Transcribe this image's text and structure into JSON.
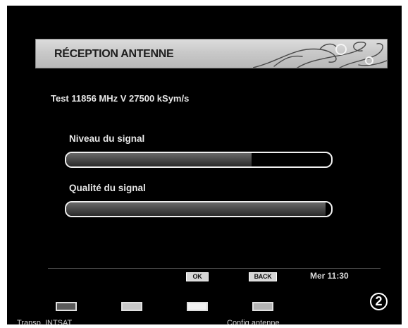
{
  "header": {
    "title": "RÉCEPTION ANTENNE"
  },
  "test_line": "Test 11856 MHz V 27500 kSym/s",
  "meters": [
    {
      "label": "Niveau du signal",
      "level_percent": 70
    },
    {
      "label": "Qualité du signal",
      "level_percent": 98
    }
  ],
  "keys": {
    "ok_label": "OK",
    "back_label": "BACK"
  },
  "clock": "Mer 11:30",
  "color_keys": [
    {
      "color": "#5a5a5a",
      "label": "Transp. INTSAT"
    },
    {
      "color": "#c8c8c8",
      "label": ""
    },
    {
      "color": "#f2f2f2",
      "label": ""
    },
    {
      "color": "#b4b4b4",
      "label": "Config antenne"
    }
  ],
  "badge": "2",
  "icons": {
    "banner_decoration": "floral-swirl-ornament"
  }
}
